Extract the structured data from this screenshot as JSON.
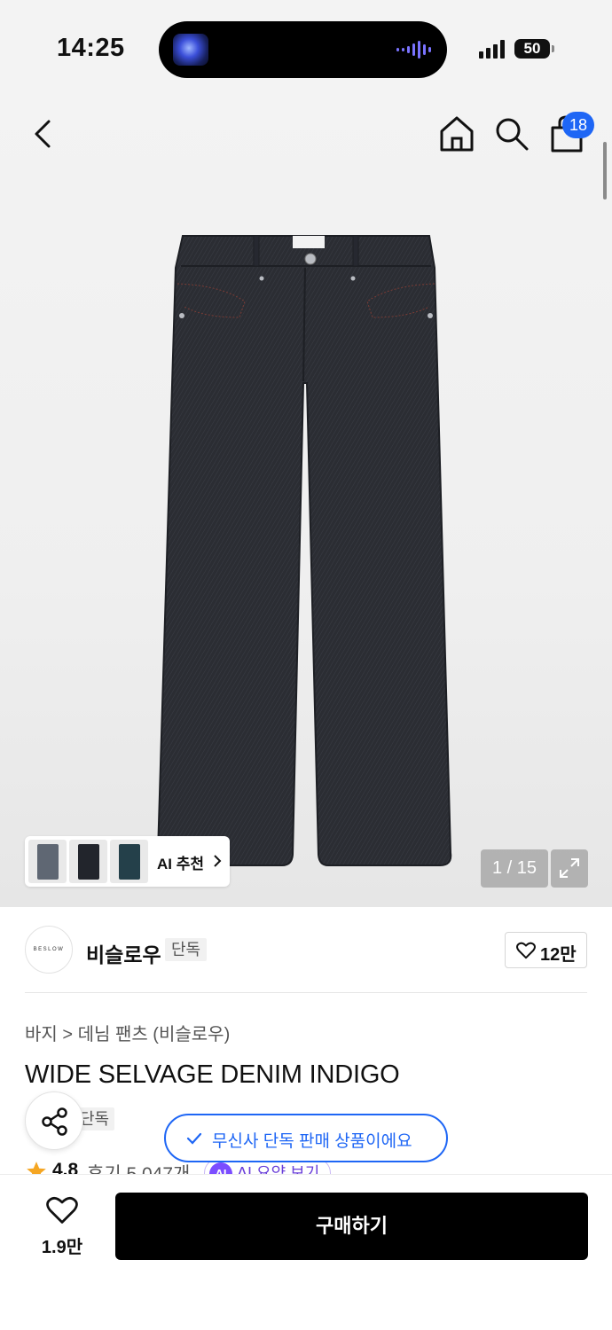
{
  "status_bar": {
    "time": "14:25",
    "battery": "50"
  },
  "header": {
    "cart_count": "18"
  },
  "gallery": {
    "ai_recommend_label": "AI 추천",
    "ai_thumb_colors": [
      "#5f6773",
      "#22252c",
      "#24404a"
    ],
    "counter": "1 / 15"
  },
  "brand": {
    "logo_text": "BESLOW",
    "name": "비슬로우",
    "tag": "단독",
    "like_count": "12만"
  },
  "product": {
    "breadcrumb": "바지 > 데님 팬츠 (비슬로우)",
    "title": "WIDE SELVAGE DENIM INDIGO",
    "exclusive_tag": "단독",
    "rating": "4.8",
    "reviews": "후기 5,047개",
    "ai_summary": "AI 요약 보기",
    "ai_summary_badge": "AI"
  },
  "toast": {
    "text": "무신사 단독 판매 상품이에요"
  },
  "bottom_bar": {
    "wish_count": "1.9만",
    "buy_label": "구매하기"
  },
  "colors": {
    "accent_blue": "#1e66f5",
    "buy_button": "#000000",
    "denim": "#2b2d33"
  }
}
